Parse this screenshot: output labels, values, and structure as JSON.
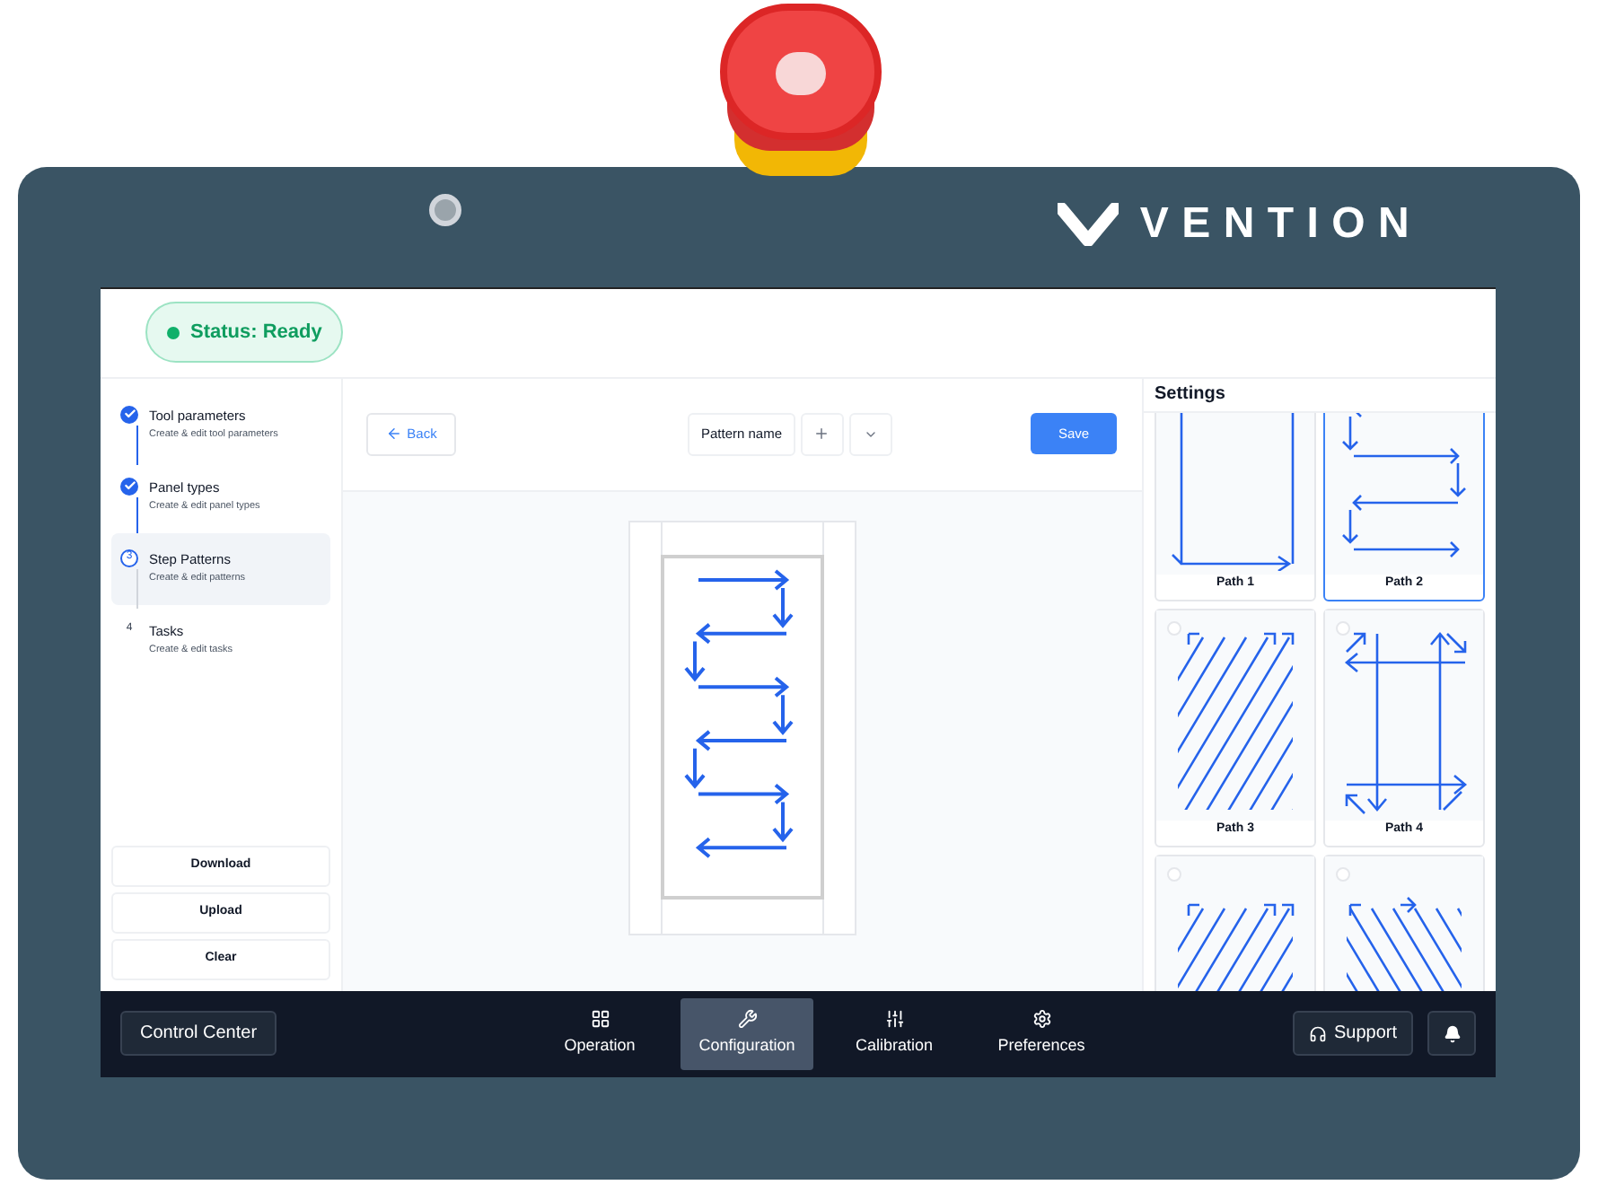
{
  "brand": {
    "name": "VENTION"
  },
  "status": {
    "label": "Status: Ready"
  },
  "steps": [
    {
      "kind": "done",
      "title": "Tool parameters",
      "subtitle": "Create & edit tool parameters",
      "selected": false
    },
    {
      "kind": "done",
      "title": "Panel types",
      "subtitle": "Create & edit panel types",
      "selected": false
    },
    {
      "kind": "current",
      "number": "3",
      "title": "Step Patterns",
      "subtitle": "Create & edit patterns",
      "selected": true
    },
    {
      "kind": "pending",
      "number": "4",
      "title": "Tasks",
      "subtitle": "Create & edit tasks",
      "selected": false
    }
  ],
  "sidebar_actions": [
    "Download",
    "Upload",
    "Clear"
  ],
  "toolbar": {
    "back": "Back",
    "pattern_name": "Pattern name",
    "save": "Save"
  },
  "settings": {
    "title": "Settings",
    "paths": [
      {
        "label": "Path 1",
        "kind": "perimeter",
        "selected": false
      },
      {
        "label": "Path 2",
        "kind": "serpentine",
        "selected": true
      },
      {
        "label": "Path 3",
        "kind": "diagonal",
        "selected": false
      },
      {
        "label": "Path 4",
        "kind": "cross",
        "selected": false
      },
      {
        "kind": "diagonal",
        "selected": false
      },
      {
        "kind": "antidiagonal",
        "selected": false
      }
    ]
  },
  "nav": {
    "control_center": "Control Center",
    "tabs": [
      {
        "label": "Operation",
        "selected": false
      },
      {
        "label": "Configuration",
        "selected": true
      },
      {
        "label": "Calibration",
        "selected": false
      },
      {
        "label": "Preferences",
        "selected": false
      }
    ],
    "support": "Support"
  }
}
